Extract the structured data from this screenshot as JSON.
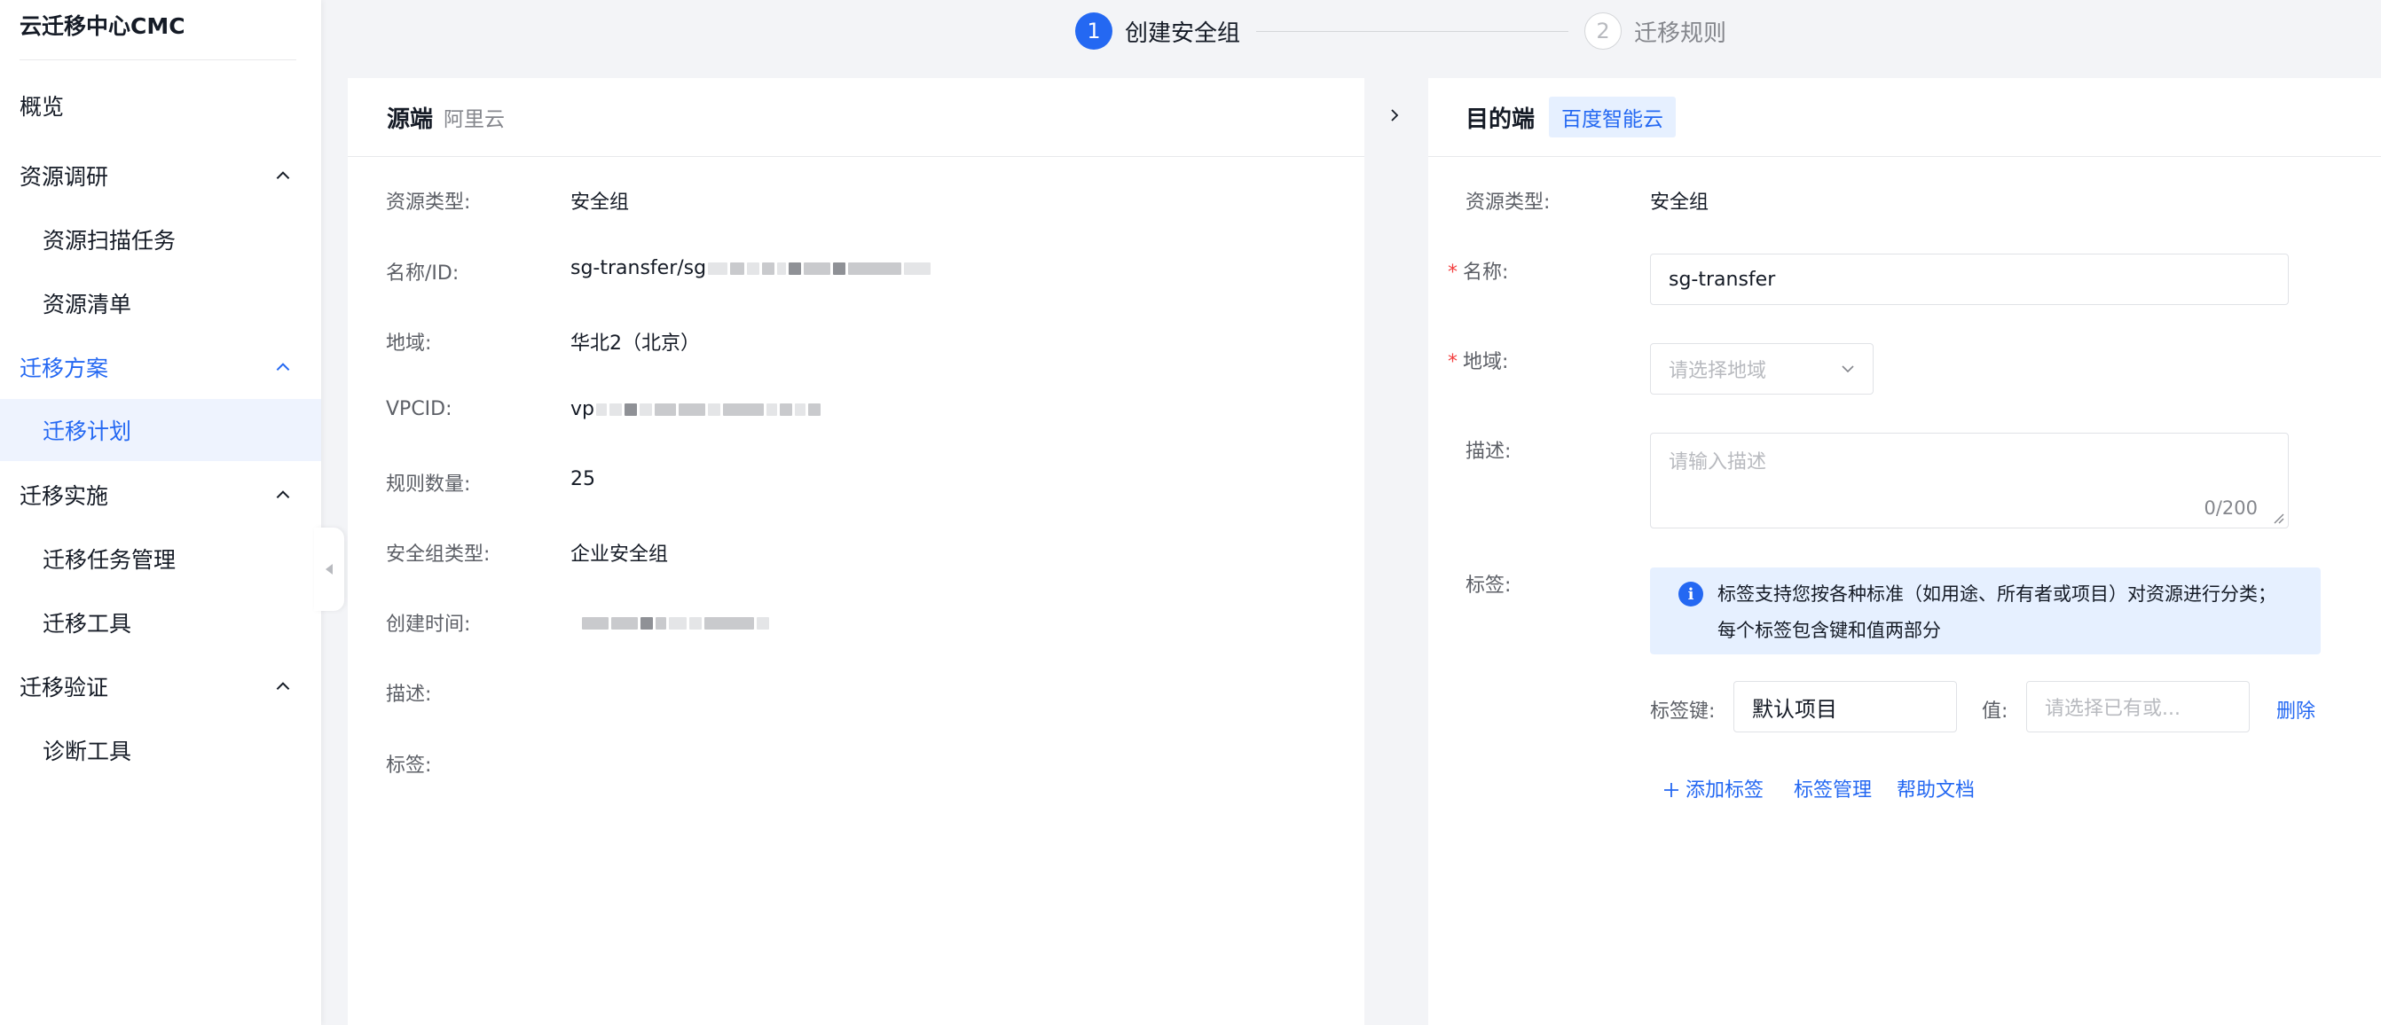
{
  "app": {
    "title": "云迁移中心CMC"
  },
  "sidebar": {
    "items": [
      {
        "label": "概览"
      },
      {
        "label": "资源调研"
      },
      {
        "label": "资源扫描任务"
      },
      {
        "label": "资源清单"
      },
      {
        "label": "迁移方案"
      },
      {
        "label": "迁移计划"
      },
      {
        "label": "迁移实施"
      },
      {
        "label": "迁移任务管理"
      },
      {
        "label": "迁移工具"
      },
      {
        "label": "迁移验证"
      },
      {
        "label": "诊断工具"
      }
    ]
  },
  "stepper": {
    "steps": [
      {
        "num": "1",
        "label": "创建安全组",
        "state": "active"
      },
      {
        "num": "2",
        "label": "迁移规则",
        "state": "todo"
      }
    ]
  },
  "source": {
    "title": "源端",
    "provider": "阿里云",
    "fields": [
      {
        "label": "资源类型:",
        "value": "安全组"
      },
      {
        "label": "名称/ID:",
        "value": "sg-transfer/sg"
      },
      {
        "label": "地域:",
        "value": "华北2（北京）"
      },
      {
        "label": "VPCID:",
        "value": "vp"
      },
      {
        "label": "规则数量:",
        "value": "25"
      },
      {
        "label": "安全组类型:",
        "value": "企业安全组"
      },
      {
        "label": "创建时间:",
        "value": ""
      },
      {
        "label": "描述:",
        "value": ""
      },
      {
        "label": "标签:",
        "value": ""
      }
    ]
  },
  "target": {
    "title": "目的端",
    "provider": "百度智能云",
    "resource_type_label": "资源类型:",
    "resource_type_value": "安全组",
    "name_label": "名称:",
    "name_value": "sg-transfer",
    "region_label": "地域:",
    "region_placeholder": "请选择地域",
    "desc_label": "描述:",
    "desc_placeholder": "请输入描述",
    "desc_counter": "0/200",
    "tags_label": "标签:",
    "tags_info_line1": "标签支持您按各种标准（如用途、所有者或项目）对资源进行分类；",
    "tags_info_line2": "每个标签包含键和值两部分",
    "tag_key_label": "标签键:",
    "tag_key_value": "默认项目",
    "tag_value_label": "值:",
    "tag_value_placeholder": "请选择已有或...",
    "delete_label": "删除",
    "add_tag_label": "添加标签",
    "tag_manage_label": "标签管理",
    "help_doc_label": "帮助文档"
  },
  "theme": {
    "accent": "#2468f2",
    "required": "#f33e3e",
    "info_bg": "#e6f0ff"
  },
  "icons": [
    "chevron-up-icon",
    "chevron-right-icon",
    "chevron-down-icon",
    "caret-left-icon",
    "info-icon",
    "plus-icon"
  ]
}
